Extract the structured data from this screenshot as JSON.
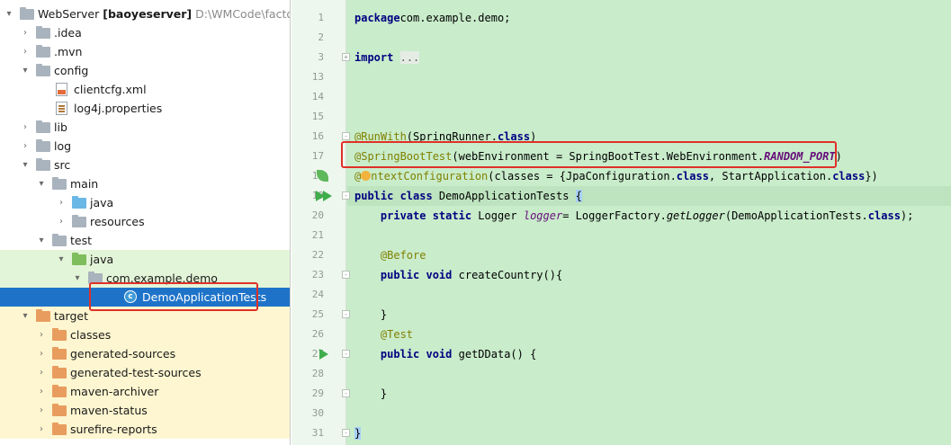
{
  "tree": {
    "items": [
      {
        "arrow": "▾",
        "icon": "f-module",
        "label": "WebServer",
        "label_bold": "[baoyeserver]",
        "path": "D:\\WMCode\\factory\\",
        "indent": 4,
        "bg": "",
        "icon_name": "module-folder-icon"
      },
      {
        "arrow": "›",
        "icon": "f-gray",
        "label": ".idea",
        "indent": 22,
        "bg": "",
        "icon_name": "folder-icon"
      },
      {
        "arrow": "›",
        "icon": "f-gray",
        "label": ".mvn",
        "indent": 22,
        "bg": "",
        "icon_name": "folder-icon"
      },
      {
        "arrow": "▾",
        "icon": "f-gray",
        "label": "config",
        "indent": 22,
        "bg": "",
        "icon_name": "folder-icon"
      },
      {
        "arrow": "",
        "icon": "file-xml",
        "label": "clientcfg.xml",
        "indent": 44,
        "bg": "",
        "icon_name": "xml-file-icon"
      },
      {
        "arrow": "",
        "icon": "file-prop",
        "label": "log4j.properties",
        "indent": 44,
        "bg": "",
        "icon_name": "properties-file-icon"
      },
      {
        "arrow": "›",
        "icon": "f-gray",
        "label": "lib",
        "indent": 22,
        "bg": "",
        "icon_name": "folder-icon"
      },
      {
        "arrow": "›",
        "icon": "f-gray",
        "label": "log",
        "indent": 22,
        "bg": "",
        "icon_name": "folder-icon"
      },
      {
        "arrow": "▾",
        "icon": "f-gray",
        "label": "src",
        "indent": 22,
        "bg": "",
        "icon_name": "folder-icon"
      },
      {
        "arrow": "▾",
        "icon": "f-gray",
        "label": "main",
        "indent": 40,
        "bg": "",
        "icon_name": "folder-icon"
      },
      {
        "arrow": "›",
        "icon": "f-blue",
        "label": "java",
        "indent": 62,
        "bg": "",
        "icon_name": "source-folder-icon"
      },
      {
        "arrow": "›",
        "icon": "f-gray",
        "label": "resources",
        "indent": 62,
        "bg": "",
        "icon_name": "resources-folder-icon"
      },
      {
        "arrow": "▾",
        "icon": "f-gray",
        "label": "test",
        "indent": 40,
        "bg": "",
        "icon_name": "folder-icon"
      },
      {
        "arrow": "▾",
        "icon": "f-green",
        "label": "java",
        "indent": 62,
        "bg": "green",
        "icon_name": "test-source-folder-icon"
      },
      {
        "arrow": "▾",
        "icon": "f-gray",
        "label": "com.example.demo",
        "indent": 80,
        "bg": "green",
        "icon_name": "package-icon"
      },
      {
        "arrow": "",
        "icon": "class-ico",
        "label": "DemoApplicationTests",
        "indent": 120,
        "bg": "sel",
        "icon_name": "test-class-icon"
      },
      {
        "arrow": "▾",
        "icon": "f-orange",
        "label": "target",
        "indent": 22,
        "bg": "yellow",
        "icon_name": "excluded-folder-icon"
      },
      {
        "arrow": "›",
        "icon": "f-orange",
        "label": "classes",
        "indent": 40,
        "bg": "yellow",
        "icon_name": "excluded-folder-icon"
      },
      {
        "arrow": "›",
        "icon": "f-orange",
        "label": "generated-sources",
        "indent": 40,
        "bg": "yellow",
        "icon_name": "excluded-folder-icon"
      },
      {
        "arrow": "›",
        "icon": "f-orange",
        "label": "generated-test-sources",
        "indent": 40,
        "bg": "yellow",
        "icon_name": "excluded-folder-icon"
      },
      {
        "arrow": "›",
        "icon": "f-orange",
        "label": "maven-archiver",
        "indent": 40,
        "bg": "yellow",
        "icon_name": "excluded-folder-icon"
      },
      {
        "arrow": "›",
        "icon": "f-orange",
        "label": "maven-status",
        "indent": 40,
        "bg": "yellow",
        "icon_name": "excluded-folder-icon"
      },
      {
        "arrow": "›",
        "icon": "f-orange",
        "label": "surefire-reports",
        "indent": 40,
        "bg": "yellow",
        "icon_name": "excluded-folder-icon"
      }
    ]
  },
  "editor": {
    "lines": [
      {
        "n": "1",
        "segs": [
          [
            "kw",
            "package"
          ],
          [
            "",
            "com.example.demo;"
          ]
        ]
      },
      {
        "n": "2",
        "segs": []
      },
      {
        "n": "3",
        "segs": [
          [
            "kw",
            "import"
          ],
          [
            "",
            " "
          ],
          [
            "fold-txt",
            "..."
          ]
        ]
      },
      {
        "n": "13",
        "segs": []
      },
      {
        "n": "14",
        "segs": []
      },
      {
        "n": "15",
        "segs": []
      },
      {
        "n": "16",
        "segs": [
          [
            "ann",
            "@RunWith"
          ],
          [
            "",
            "(SpringRunner."
          ],
          [
            "kw",
            "class"
          ],
          [
            "",
            ")"
          ]
        ]
      },
      {
        "n": "17",
        "segs": [
          [
            "ann",
            "@SpringBootTest"
          ],
          [
            "",
            "(webEnvironment = SpringBootTest.WebEnvironment."
          ],
          [
            "const",
            "RANDOM_PORT"
          ],
          [
            "",
            ")"
          ]
        ]
      },
      {
        "n": "18",
        "segs": [
          [
            "ann",
            "@"
          ],
          [
            "bulb",
            ""
          ],
          [
            "ann",
            "ntextConfiguration"
          ],
          [
            "",
            "(classes = {JpaConfiguration."
          ],
          [
            "kw",
            "class"
          ],
          [
            "",
            ", StartApplication."
          ],
          [
            "kw",
            "class"
          ],
          [
            "",
            "})"
          ]
        ]
      },
      {
        "n": "19",
        "segs": [
          [
            "kw",
            "public class"
          ],
          [
            "",
            " DemoApplicationTests "
          ],
          [
            "brace-hl",
            "{"
          ]
        ]
      },
      {
        "n": "20",
        "segs": [
          [
            "",
            "    "
          ],
          [
            "kw",
            "private static"
          ],
          [
            "",
            " Logger "
          ],
          [
            "logger",
            "logger"
          ],
          [
            "",
            "= LoggerFactory."
          ],
          [
            "it",
            "getLogger"
          ],
          [
            "",
            "(DemoApplicationTests."
          ],
          [
            "kw",
            "class"
          ],
          [
            "",
            ");"
          ]
        ]
      },
      {
        "n": "21",
        "segs": []
      },
      {
        "n": "22",
        "segs": [
          [
            "",
            "    "
          ],
          [
            "ann",
            "@Before"
          ]
        ]
      },
      {
        "n": "23",
        "segs": [
          [
            "",
            "    "
          ],
          [
            "kw",
            "public void"
          ],
          [
            "",
            " createCountry(){"
          ]
        ]
      },
      {
        "n": "24",
        "segs": []
      },
      {
        "n": "25",
        "segs": [
          [
            "",
            "    }"
          ]
        ]
      },
      {
        "n": "26",
        "segs": [
          [
            "",
            "    "
          ],
          [
            "ann",
            "@Test"
          ]
        ]
      },
      {
        "n": "27",
        "segs": [
          [
            "",
            "    "
          ],
          [
            "kw",
            "public void"
          ],
          [
            "",
            " getDData() {"
          ]
        ]
      },
      {
        "n": "28",
        "segs": []
      },
      {
        "n": "29",
        "segs": [
          [
            "",
            "    }"
          ]
        ]
      },
      {
        "n": "30",
        "segs": []
      },
      {
        "n": "31",
        "segs": [
          [
            "brace-hl",
            "}"
          ]
        ]
      }
    ]
  }
}
